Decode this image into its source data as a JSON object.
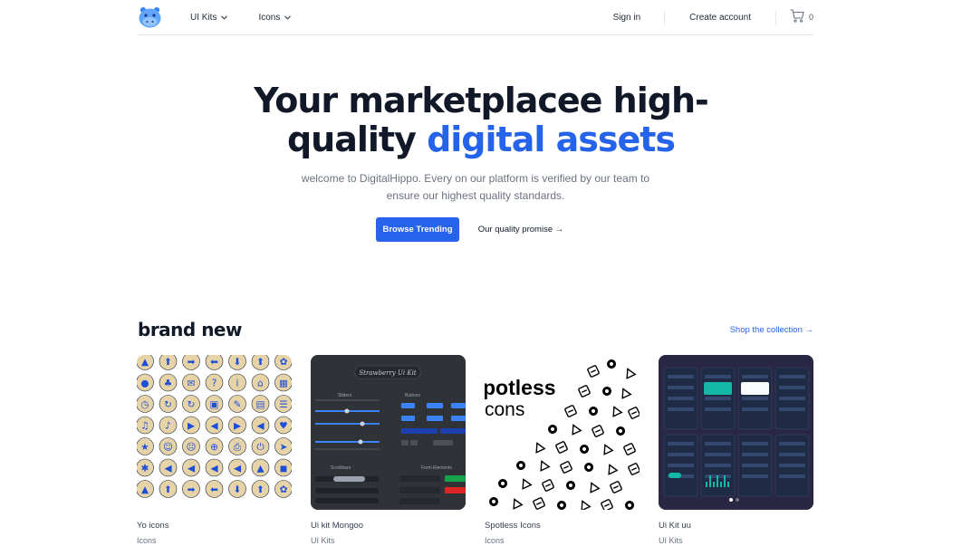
{
  "nav": {
    "menus": [
      {
        "label": "UI Kits"
      },
      {
        "label": "Icons"
      }
    ],
    "sign_in": "Sign in",
    "create_account": "Create account",
    "cart_count": "0"
  },
  "hero": {
    "title_part1": "Your marketplacee high-",
    "title_part2": "quality ",
    "title_accent": "digital assets",
    "subtitle": "welcome to DigitalHippo. Every on our platform is verified by our team to ensure our highest quality standards.",
    "primary_button": "Browse Trending",
    "secondary_button": "Our quality promise →"
  },
  "section": {
    "title": "brand new",
    "link": "Shop the collection →"
  },
  "products": [
    {
      "name": "Yo icons",
      "category": "Icons"
    },
    {
      "name": "Ui kit Mongoo",
      "category": "UI Kits"
    },
    {
      "name": "Spotless Icons",
      "category": "Icons"
    },
    {
      "name": "Ui Kit uu",
      "category": "UI Kits"
    }
  ],
  "thumb_text": {
    "mongo_banner": "Strawberry Ui Kit",
    "mongo_sliders": "Sliders",
    "mongo_buttons": "Buttons",
    "mongo_scrollbars": "Scrollbars",
    "mongo_form": "Form Elements",
    "spot_line1": "potless",
    "spot_line2": "cons"
  },
  "colors": {
    "accent": "#2563eb",
    "text": "#111827",
    "muted": "#6b7280",
    "icon_tile": "#e6d3a8",
    "icon_blue": "#1d4ed8"
  }
}
